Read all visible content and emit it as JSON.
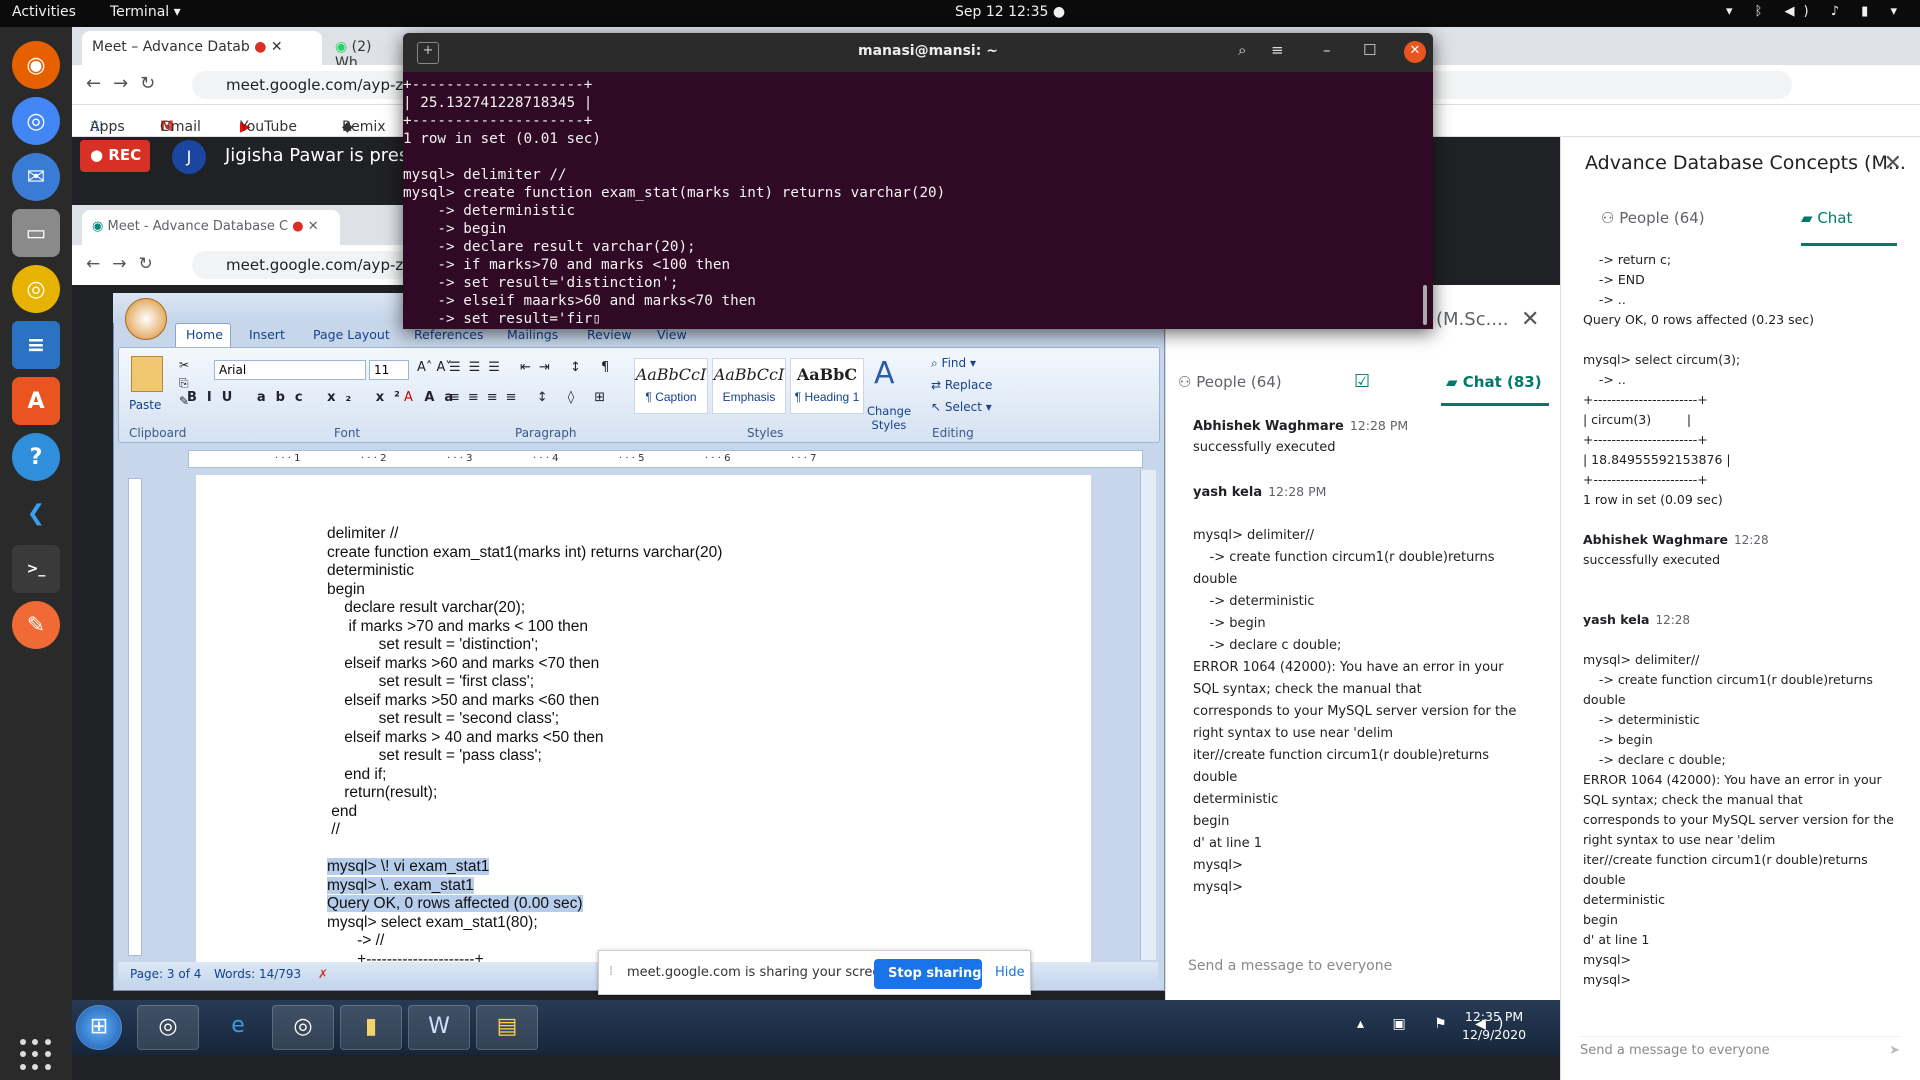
{
  "topbar": {
    "activities": "Activities",
    "app_name": "Terminal ▾",
    "clock": "Sep 12  12:35  ●",
    "tray": "▾ ᛒ ◀) ♪ ▮ ▾"
  },
  "dock": {
    "apps": [
      "Firefox",
      "Chrome",
      "Thunderbird",
      "Files",
      "Rhythmbox",
      "LibreOffice Writer",
      "Ubuntu Software",
      "Help",
      "VS Code",
      "Terminal",
      "Postman"
    ]
  },
  "chrome": {
    "tab1": "Meet – Advance Datab",
    "tab2": "(2) Wh",
    "url": "meet.google.com/ayp-zzce-zu",
    "bookmarks": [
      "Apps",
      "Gmail",
      "YouTube",
      "Remix"
    ]
  },
  "meet": {
    "rec": "REC",
    "presenter_initial": "J",
    "presenter_text": "Jigisha Pawar is prese"
  },
  "right_panel": {
    "title": "Advance Database Concepts (M...",
    "people_tab": "People (64)",
    "chat_tab": "Chat",
    "send_placeholder": "Send a message to everyone",
    "lines": [
      {
        "t": "    -> return c;"
      },
      {
        "t": "    -> END"
      },
      {
        "t": "    -> .."
      },
      {
        "t": "Query OK, 0 rows affected (0.23 sec)"
      },
      {
        "t": ""
      },
      {
        "t": "mysql> select circum(3);"
      },
      {
        "t": "    -> .."
      },
      {
        "t": "+-----------------------+"
      },
      {
        "t": "| circum(3)         |"
      },
      {
        "t": "+-----------------------+"
      },
      {
        "t": "| 18.84955592153876 |"
      },
      {
        "t": "+-----------------------+"
      },
      {
        "t": "1 row in set (0.09 sec)"
      },
      {
        "t": ""
      },
      {
        "sender": "Abhishek Waghmare",
        "time": "12:28"
      },
      {
        "t": "successfully executed"
      },
      {
        "t": ""
      },
      {
        "t": ""
      },
      {
        "sender": "yash kela",
        "time": "12:28"
      },
      {
        "t": ""
      },
      {
        "t": "mysql> delimiter//"
      },
      {
        "t": "    -> create function circum1(r double)returns"
      },
      {
        "t": "double"
      },
      {
        "t": "    -> deterministic"
      },
      {
        "t": "    -> begin"
      },
      {
        "t": "    -> declare c double;"
      },
      {
        "t": "ERROR 1064 (42000): You have an error in your"
      },
      {
        "t": "SQL syntax; check the manual that"
      },
      {
        "t": "corresponds to your MySQL server version for the"
      },
      {
        "t": "right syntax to use near 'delim"
      },
      {
        "t": "iter//create function circum1(r double)returns"
      },
      {
        "t": "double"
      },
      {
        "t": "deterministic"
      },
      {
        "t": "begin"
      },
      {
        "t": "d' at line 1"
      },
      {
        "t": "mysql>"
      },
      {
        "t": "mysql>"
      }
    ]
  },
  "inner_browser": {
    "tab1": "Meet - Advance Database C",
    "url": "meet.google.com/ayp-zzc"
  },
  "inner_meet": {
    "header": "(M.Sc....",
    "people_tab": "People (64)",
    "chat_tab": "Chat (83)",
    "send_placeholder": "Send a message to everyone",
    "lines": [
      {
        "sender": "Abhishek Waghmare",
        "time": "12:28 PM"
      },
      {
        "t": "successfully executed"
      },
      {
        "t": ""
      },
      {
        "sender": "yash kela",
        "time": "12:28 PM"
      },
      {
        "t": ""
      },
      {
        "t": "mysql> delimiter//"
      },
      {
        "t": "    -> create function circum1(r double)returns"
      },
      {
        "t": "double"
      },
      {
        "t": "    -> deterministic"
      },
      {
        "t": "    -> begin"
      },
      {
        "t": "    -> declare c double;"
      },
      {
        "t": "ERROR 1064 (42000): You have an error in your"
      },
      {
        "t": "SQL syntax; check the manual that"
      },
      {
        "t": "corresponds to your MySQL server version for the"
      },
      {
        "t": "right syntax to use near 'delim"
      },
      {
        "t": "iter//create function circum1(r double)returns"
      },
      {
        "t": "double"
      },
      {
        "t": "deterministic"
      },
      {
        "t": "begin"
      },
      {
        "t": "d' at line 1"
      },
      {
        "t": "mysql>"
      },
      {
        "t": "mysql>"
      }
    ]
  },
  "word": {
    "tabs": [
      "Home",
      "Insert",
      "Page Layout",
      "References",
      "Mailings",
      "Review",
      "View"
    ],
    "font_name": "Arial",
    "font_size": "11",
    "paste": "Paste",
    "groups": [
      "Clipboard",
      "Font",
      "Paragraph",
      "Styles",
      "Editing"
    ],
    "styles": [
      {
        "sample": "AaBbCcI",
        "name": "¶ Caption"
      },
      {
        "sample": "AaBbCcI",
        "name": "Emphasis"
      },
      {
        "sample": "AaBbC",
        "name": "¶ Heading 1"
      }
    ],
    "change_styles": "Change Styles",
    "find": "Find ▾",
    "replace": "Replace",
    "select": "Select ▾",
    "status_page": "Page: 3 of 4",
    "status_words": "Words: 14/793",
    "doc_lines": [
      {
        "t": "delimiter //"
      },
      {
        "t": "create function exam_stat1(marks int) returns varchar(20)"
      },
      {
        "t": "deterministic"
      },
      {
        "t": "begin"
      },
      {
        "t": "    declare result varchar(20);"
      },
      {
        "t": "     if marks >70 and marks < 100 then"
      },
      {
        "t": "            set result = 'distinction';"
      },
      {
        "t": "    elseif marks >60 and marks <70 then"
      },
      {
        "t": "            set result = 'first class';"
      },
      {
        "t": "    elseif marks >50 and marks <60 then"
      },
      {
        "t": "            set result = 'second class';"
      },
      {
        "t": "    elseif marks > 40 and marks <50 then"
      },
      {
        "t": "            set result = 'pass class';"
      },
      {
        "t": "    end if;"
      },
      {
        "t": "    return(result);"
      },
      {
        "t": " end"
      },
      {
        "t": " //"
      },
      {
        "t": ""
      },
      {
        "t": "mysql> \\! vi exam_stat1",
        "hl": true
      },
      {
        "t": "mysql> \\. exam_stat1",
        "hl": true
      },
      {
        "t": "Query OK, 0 rows affected (0.00 sec)",
        "hl": true
      },
      {
        "t": "mysql> select exam_stat1(80);"
      },
      {
        "t": "       -> //"
      },
      {
        "t": "       +---------------------+"
      }
    ]
  },
  "sharebar": {
    "message": "meet.google.com is sharing your screen.",
    "stop": "Stop sharing",
    "hide": "Hide"
  },
  "win_taskbar": {
    "time": "12:35 PM",
    "date": "12/9/2020"
  },
  "terminal": {
    "title": "manasi@mansi: ~",
    "lines": [
      "+--------------------+",
      "| 25.132741228718345 |",
      "+--------------------+",
      "1 row in set (0.01 sec)",
      "",
      "mysql> delimiter //",
      "mysql> create function exam_stat(marks int) returns varchar(20)",
      "    -> deterministic",
      "    -> begin",
      "    -> declare result varchar(20);",
      "    -> if marks>70 and marks <100 then",
      "    -> set result='distinction';",
      "    -> elseif maarks>60 and marks<70 then",
      "    -> set result='fir▯"
    ]
  }
}
